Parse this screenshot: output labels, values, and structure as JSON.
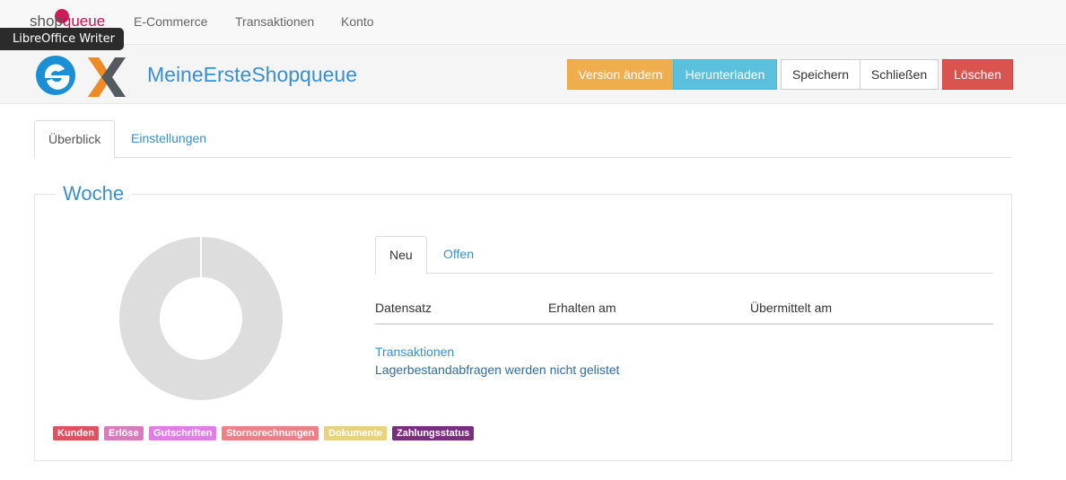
{
  "tooltip": "LibreOffice Writer",
  "brand": {
    "part1": "shop",
    "part2": "queue"
  },
  "nav": [
    "E-Commerce",
    "Transaktionen",
    "Konto"
  ],
  "header": {
    "title": "MeineErsteShopqueue",
    "buttons": {
      "version": "Version ändern",
      "download": "Herunterladen",
      "save": "Speichern",
      "close": "Schließen",
      "delete": "Löschen"
    }
  },
  "tabs": [
    "Überblick",
    "Einstellungen"
  ],
  "panel": {
    "title": "Woche"
  },
  "donut": {
    "color": "#dddddd",
    "values": [
      100
    ]
  },
  "legend": [
    {
      "label": "Kunden",
      "color": "#e0505e"
    },
    {
      "label": "Erlöse",
      "color": "#d77bbd"
    },
    {
      "label": "Gutschriften",
      "color": "#e27ce6"
    },
    {
      "label": "Stornorechnungen",
      "color": "#ee7f86"
    },
    {
      "label": "Dokumente",
      "color": "#e8d27c"
    },
    {
      "label": "Zahlungsstatus",
      "color": "#7b2e7d"
    }
  ],
  "subtabs": [
    "Neu",
    "Offen"
  ],
  "table": {
    "columns": [
      "Datensatz",
      "Erhalten am",
      "Übermittelt am"
    ]
  },
  "links": {
    "transactions": "Transaktionen",
    "info": "Lagerbestandabfragen werden nicht gelistet"
  },
  "colors": {
    "accent": "#3a8fd0",
    "brand": "#c8124e"
  }
}
